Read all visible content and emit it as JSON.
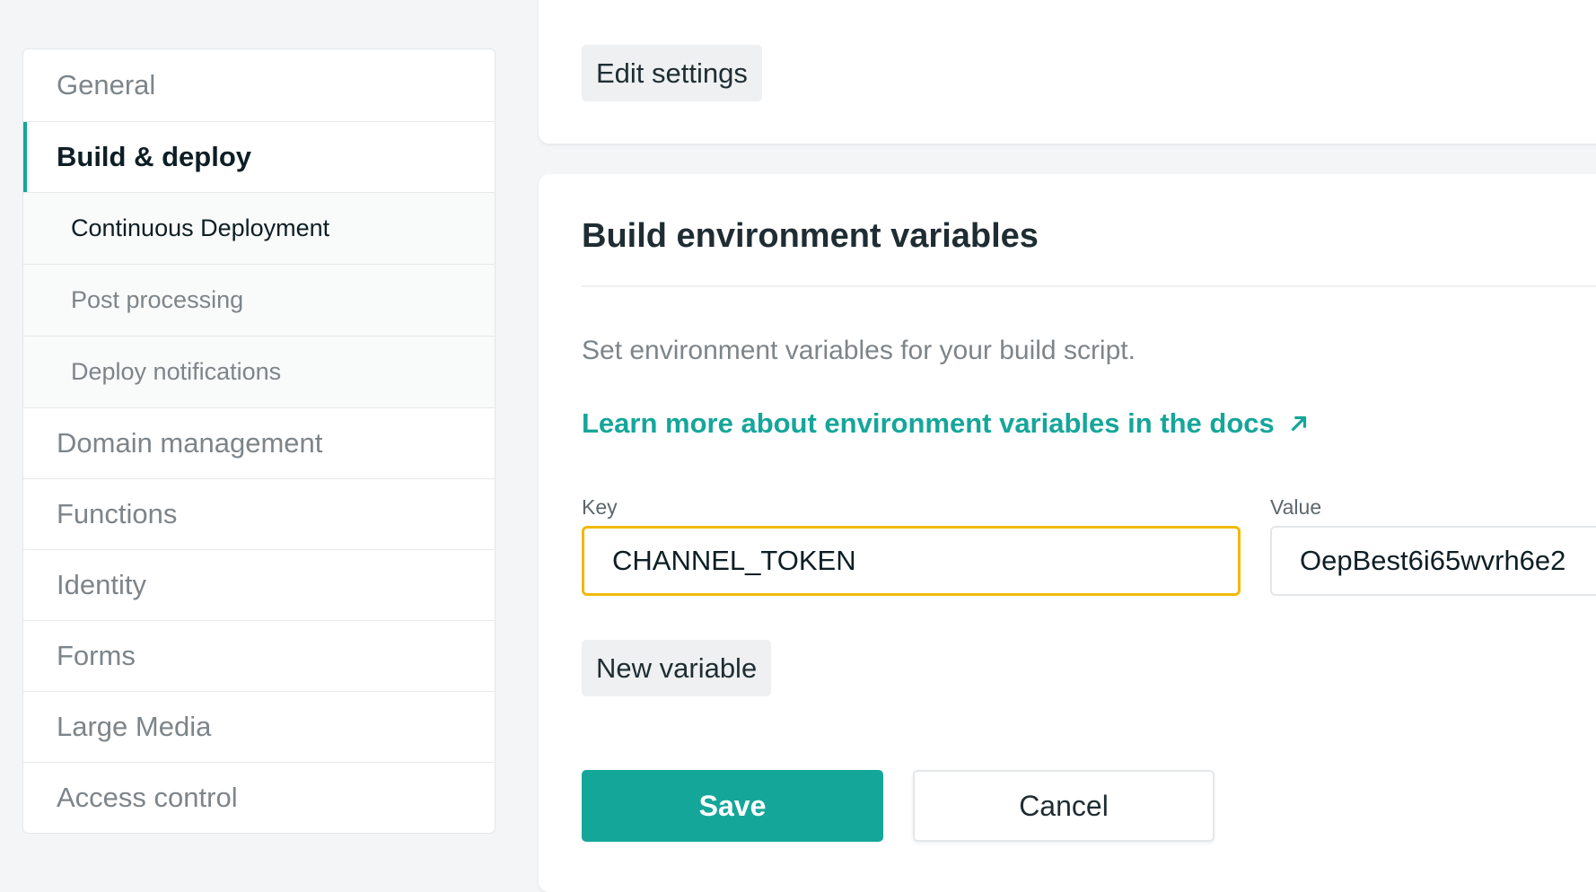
{
  "sidebar": {
    "items": [
      {
        "label": "General"
      },
      {
        "label": "Build & deploy"
      },
      {
        "label": "Continuous Deployment"
      },
      {
        "label": "Post processing"
      },
      {
        "label": "Deploy notifications"
      },
      {
        "label": "Domain management"
      },
      {
        "label": "Functions"
      },
      {
        "label": "Identity"
      },
      {
        "label": "Forms"
      },
      {
        "label": "Large Media"
      },
      {
        "label": "Access control"
      }
    ]
  },
  "top_card": {
    "edit_label": "Edit settings"
  },
  "env": {
    "title": "Build environment variables",
    "description": "Set environment variables for your build script.",
    "docs_link": "Learn more about environment variables in the docs",
    "key_label": "Key",
    "value_label": "Value",
    "key_value": "CHANNEL_TOKEN",
    "value_value": "OepBest6i65wvrh6e2",
    "new_variable_label": "New variable",
    "save_label": "Save",
    "cancel_label": "Cancel"
  },
  "icons": {
    "docs_link_icon": "external-arrow-icon"
  },
  "colors": {
    "accent": "#15a69a",
    "focus_border": "#f0b90b",
    "background": "#f3f5f7"
  }
}
